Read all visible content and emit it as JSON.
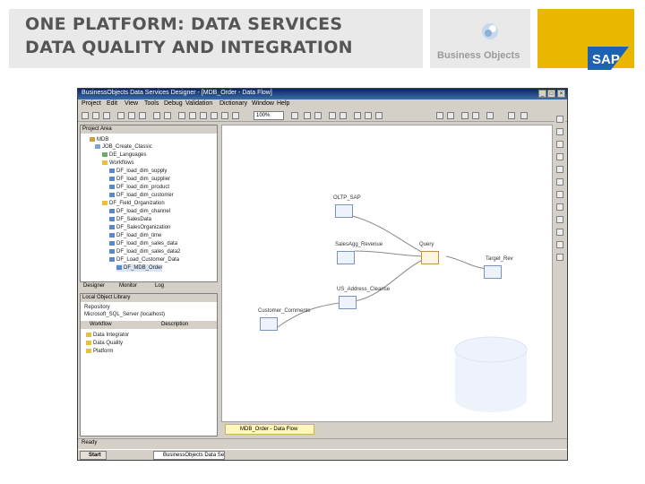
{
  "slide": {
    "title_line1": "ONE PLATFORM: DATA SERVICES",
    "title_line2": "DATA QUALITY AND INTEGRATION",
    "bo_logo_text": "Business Objects",
    "sap_logo_text": "SAP"
  },
  "colors": {
    "title_text": "#555555",
    "sap_band": "#e9b700",
    "window_title": "#0a246a"
  },
  "app": {
    "window_title": "BusinessObjects Data Services Designer - [MDB_Order - Data Flow]",
    "menu": [
      "Project",
      "Edit",
      "View",
      "Tools",
      "Debug",
      "Validation",
      "Dictionary",
      "Window",
      "Help"
    ],
    "toolbar_combo": "100%",
    "project_area": {
      "header": "Project Area",
      "items": [
        "MDB",
        "JOB_Create_Classic",
        "DE_Languages",
        "Workflows",
        "DF_load_dim_supply",
        "DF_load_dim_supplier",
        "DF_load_dim_product",
        "DF_load_dim_customer",
        "DF_Field_Organization",
        "DF_load_dim_channel",
        "DF_SalesData",
        "DF_SalesOrganization",
        "DF_load_dim_time",
        "DF_load_dim_sales_data",
        "DF_load_dim_sales_data2",
        "DF_Load_Customer_Data",
        "DF_MDB_Order"
      ],
      "tabs": [
        "Designer",
        "Monitor",
        "Log"
      ]
    },
    "local_library": {
      "header": "Local Object Library",
      "repository_label": "Repository",
      "path": "Microsoft_SQL_Server (localhost)",
      "columns": [
        "Workflow",
        "Description"
      ],
      "items": [
        "Data Integrator",
        "Data Quality",
        "Platform"
      ]
    },
    "data_flow": {
      "nodes": [
        {
          "label": "OLTP_SAP"
        },
        {
          "label": "SalesAgg_Revenue"
        },
        {
          "label": "Query"
        },
        {
          "label": "Target_Rev"
        },
        {
          "label": "US_Address_Cleanse"
        },
        {
          "label": "Customer_Comments"
        }
      ]
    },
    "doc_tab": "MDB_Order - Data Flow",
    "status_text": "Ready",
    "taskbar": {
      "start": "Start",
      "task": "BusinessObjects Data Services"
    }
  }
}
